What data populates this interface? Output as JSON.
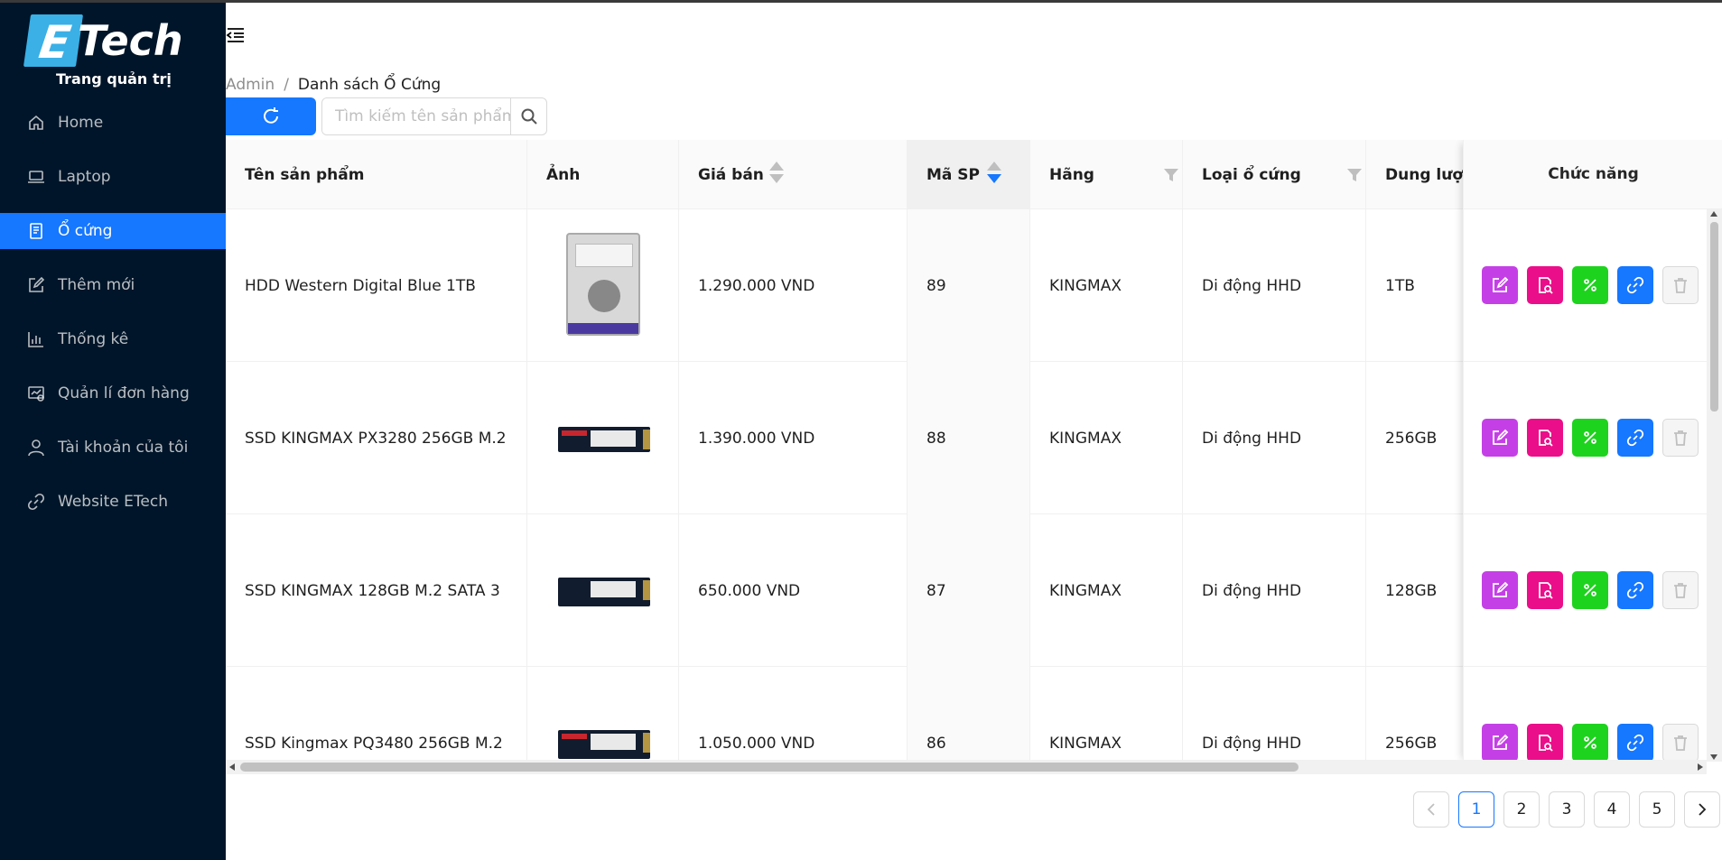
{
  "logo": {
    "letter": "E",
    "text": "Tech",
    "subtitle": "Trang quản trị"
  },
  "sidebar": {
    "items": [
      {
        "label": "Home",
        "icon": "home-icon"
      },
      {
        "label": "Laptop",
        "icon": "laptop-icon"
      },
      {
        "label": "Ổ cứng",
        "icon": "hard-drive-icon",
        "active": true
      },
      {
        "label": "Thêm mới",
        "icon": "edit-icon"
      },
      {
        "label": "Thống kê",
        "icon": "bar-chart-icon"
      },
      {
        "label": "Quản lí đơn hàng",
        "icon": "orders-icon"
      },
      {
        "label": "Tài khoản của tôi",
        "icon": "user-icon"
      },
      {
        "label": "Website ETech",
        "icon": "link-icon"
      }
    ]
  },
  "breadcrumb": {
    "root": "Admin",
    "separator": "/",
    "current": "Danh sách Ổ Cứng"
  },
  "search": {
    "placeholder": "Tìm kiếm tên sản phẩm",
    "value": ""
  },
  "table": {
    "columns": [
      "Tên sản phẩm",
      "Ảnh",
      "Giá bán",
      "Mã SP",
      "Hãng",
      "Loại ổ cứng",
      "Dung lượng",
      "Chức năng"
    ],
    "rows": [
      {
        "name": "HDD Western Digital Blue 1TB",
        "image": "hdd",
        "price": "1.290.000 VND",
        "code": "89",
        "brand": "KINGMAX",
        "type": "Di động HHD",
        "capacity": "1TB"
      },
      {
        "name": "SSD KINGMAX PX3280 256GB M.2",
        "image": "ssd",
        "price": "1.390.000 VND",
        "code": "88",
        "brand": "KINGMAX",
        "type": "Di động HHD",
        "capacity": "256GB"
      },
      {
        "name": "SSD KINGMAX 128GB M.2 SATA 3",
        "image": "ssd",
        "price": "650.000 VND",
        "code": "87",
        "brand": "KINGMAX",
        "type": "Di động HHD",
        "capacity": "128GB"
      },
      {
        "name": "SSD Kingmax PQ3480 256GB M.2",
        "image": "ssd",
        "price": "1.050.000 VND",
        "code": "86",
        "brand": "KINGMAX",
        "type": "Di động HHD",
        "capacity": "256GB"
      }
    ]
  },
  "pagination": {
    "pages": [
      "1",
      "2",
      "3",
      "4",
      "5"
    ],
    "current": "1"
  },
  "colors": {
    "sidebar_bg": "#001529",
    "accent": "#1677ff",
    "edit": "#c440e6",
    "detail": "#eb0e8a",
    "discount": "#1ed31e",
    "link": "#1677ff"
  }
}
